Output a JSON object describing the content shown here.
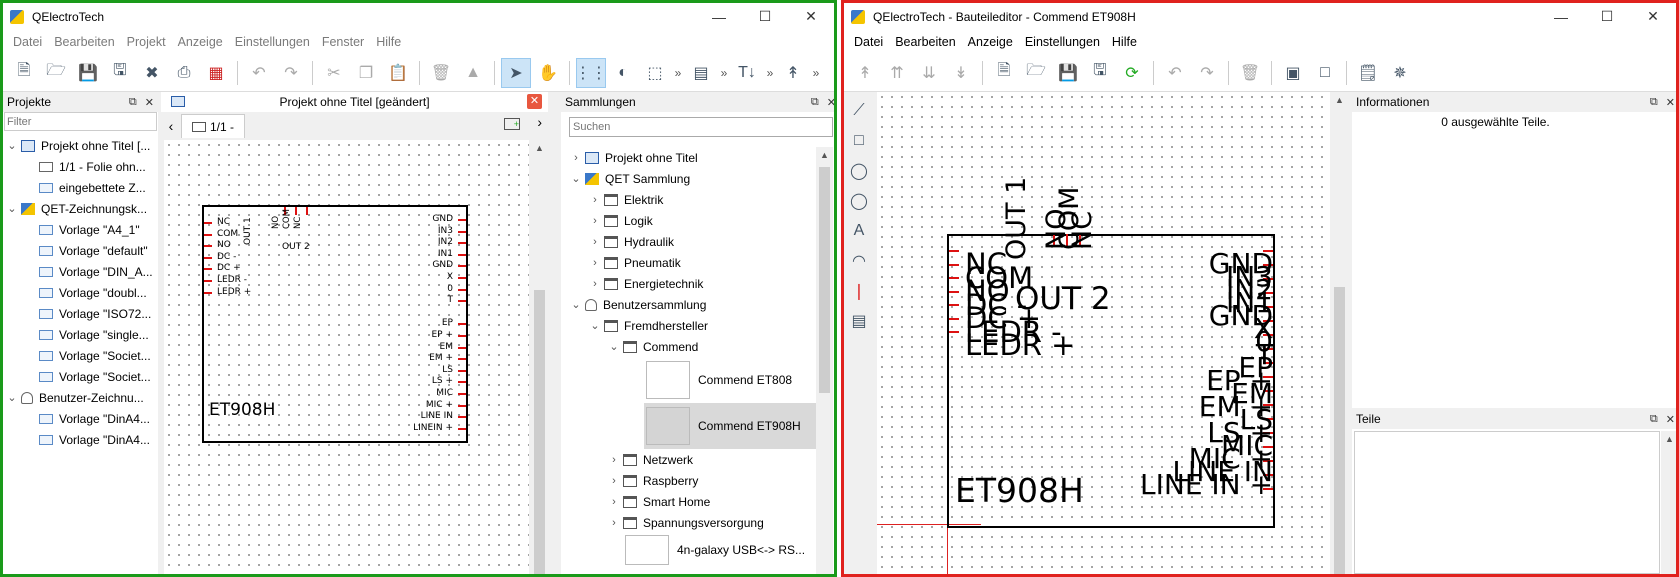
{
  "left": {
    "title": "QElectroTech",
    "menu": [
      "Datei",
      "Bearbeiten",
      "Projekt",
      "Anzeige",
      "Einstellungen",
      "Fenster",
      "Hilfe"
    ],
    "projects_panel": {
      "title": "Projekte",
      "filter_placeholder": "Filter",
      "items": [
        {
          "label": "Projekt ohne Titel [...",
          "icon": "project-icon",
          "arrow": "expanded",
          "level": 0
        },
        {
          "label": "1/1 - Folie ohn...",
          "icon": "folio-icon",
          "level": 1
        },
        {
          "label": "eingebettete Z...",
          "icon": "embedded-collection-icon",
          "level": 1
        },
        {
          "label": "QET-Zeichnungsk...",
          "icon": "qet-logo-icon",
          "arrow": "expanded",
          "level": 0
        },
        {
          "label": "Vorlage \"A4_1\"",
          "icon": "template-icon",
          "level": 1
        },
        {
          "label": "Vorlage \"default\"",
          "icon": "template-icon",
          "level": 1
        },
        {
          "label": "Vorlage \"DIN_A...",
          "icon": "template-icon",
          "level": 1
        },
        {
          "label": "Vorlage \"doubl...",
          "icon": "template-icon",
          "level": 1
        },
        {
          "label": "Vorlage \"ISO72...",
          "icon": "template-icon",
          "level": 1
        },
        {
          "label": "Vorlage \"single...",
          "icon": "template-icon",
          "level": 1
        },
        {
          "label": "Vorlage \"Societ...",
          "icon": "template-icon",
          "level": 1
        },
        {
          "label": "Vorlage \"Societ...",
          "icon": "template-icon",
          "level": 1
        },
        {
          "label": "Benutzer-Zeichnu...",
          "icon": "user-icon",
          "arrow": "expanded",
          "level": 0
        },
        {
          "label": "Vorlage \"DinA4...",
          "icon": "template-icon",
          "level": 1
        },
        {
          "label": "Vorlage \"DinA4...",
          "icon": "template-icon",
          "level": 1
        }
      ]
    },
    "document": {
      "title": "Projekt ohne Titel [geändert]",
      "tab": "1/1 -"
    },
    "element": {
      "name": "ET908H",
      "left_pins": [
        "NC",
        "COM",
        "NO",
        "DC -",
        "DC +",
        "LEDR -",
        "LEDR +"
      ],
      "top_pins": [
        "NO",
        "COM",
        "NC"
      ],
      "out1": "OUT 1",
      "out2": "OUT 2",
      "right_pins": [
        "GND",
        "IN3",
        "IN2",
        "IN1",
        "GND",
        "X",
        "0",
        "T",
        "",
        "EP",
        "EP +",
        "EM",
        "EM +",
        "LS",
        "LS +",
        "MIC",
        "MIC +",
        "LINE IN",
        "LINEIN +"
      ]
    },
    "collections_panel": {
      "title": "Sammlungen",
      "search_placeholder": "Suchen",
      "items": [
        {
          "label": "Projekt ohne Titel",
          "icon": "project-icon",
          "arrow": "collapsed",
          "level": 0
        },
        {
          "label": "QET Sammlung",
          "icon": "qet-logo-icon",
          "arrow": "expanded",
          "level": 0
        },
        {
          "label": "Elektrik",
          "icon": "folder-icon",
          "arrow": "collapsed",
          "level": 1
        },
        {
          "label": "Logik",
          "icon": "folder-icon",
          "arrow": "collapsed",
          "level": 1
        },
        {
          "label": "Hydraulik",
          "icon": "folder-icon",
          "arrow": "collapsed",
          "level": 1
        },
        {
          "label": "Pneumatik",
          "icon": "folder-icon",
          "arrow": "collapsed",
          "level": 1
        },
        {
          "label": "Energietechnik",
          "icon": "folder-icon",
          "arrow": "collapsed",
          "level": 1
        },
        {
          "label": "Benutzersammlung",
          "icon": "user-icon",
          "arrow": "expanded",
          "level": 0
        },
        {
          "label": "Fremdhersteller",
          "icon": "folder-icon",
          "arrow": "expanded",
          "level": 1
        },
        {
          "label": "Commend",
          "icon": "folder-icon",
          "arrow": "expanded",
          "level": 2
        }
      ],
      "elements": [
        {
          "label": "Commend ET808",
          "selected": false
        },
        {
          "label": "Commend ET908H",
          "selected": true
        }
      ],
      "items_after": [
        {
          "label": "Netzwerk",
          "icon": "folder-icon",
          "arrow": "collapsed",
          "level": 2
        },
        {
          "label": "Raspberry",
          "icon": "folder-icon",
          "arrow": "collapsed",
          "level": 2
        },
        {
          "label": "Smart Home",
          "icon": "folder-icon",
          "arrow": "collapsed",
          "level": 2
        },
        {
          "label": "Spannungsversorgung",
          "icon": "folder-icon",
          "arrow": "collapsed",
          "level": 2
        }
      ],
      "last_item": {
        "label": "4n-galaxy USB<-> RS..."
      }
    }
  },
  "right": {
    "title": "QElectroTech - Bauteileditor - Commend ET908H",
    "menu": [
      "Datei",
      "Bearbeiten",
      "Anzeige",
      "Einstellungen",
      "Hilfe"
    ],
    "info_panel": {
      "title": "Informationen",
      "text": "0 ausgewählte Teile."
    },
    "parts_panel": {
      "title": "Teile"
    },
    "element": {
      "name": "ET908H",
      "out1": "OUT 1",
      "out2": "OUT 2",
      "top_pins": [
        "NO",
        "COM",
        "NC"
      ],
      "left_labels": [
        "NC",
        "COM",
        "NO",
        "DC -",
        "DC +",
        "LEDR -",
        "LEDR +"
      ],
      "right_labels": [
        "GND",
        "IN3",
        "IN2",
        "IN1",
        "GND",
        "X",
        "0",
        "T",
        "EP",
        "EP +",
        "EM",
        "EM +",
        "LS",
        "LS +",
        "MIC",
        "MIC +",
        "LINE IN",
        "LINE IN +"
      ]
    }
  },
  "colors": {
    "left_border": "#1a9a1a",
    "right_border": "#e0221e",
    "pin": "#dd1111",
    "selection": "#d9d9d9"
  }
}
